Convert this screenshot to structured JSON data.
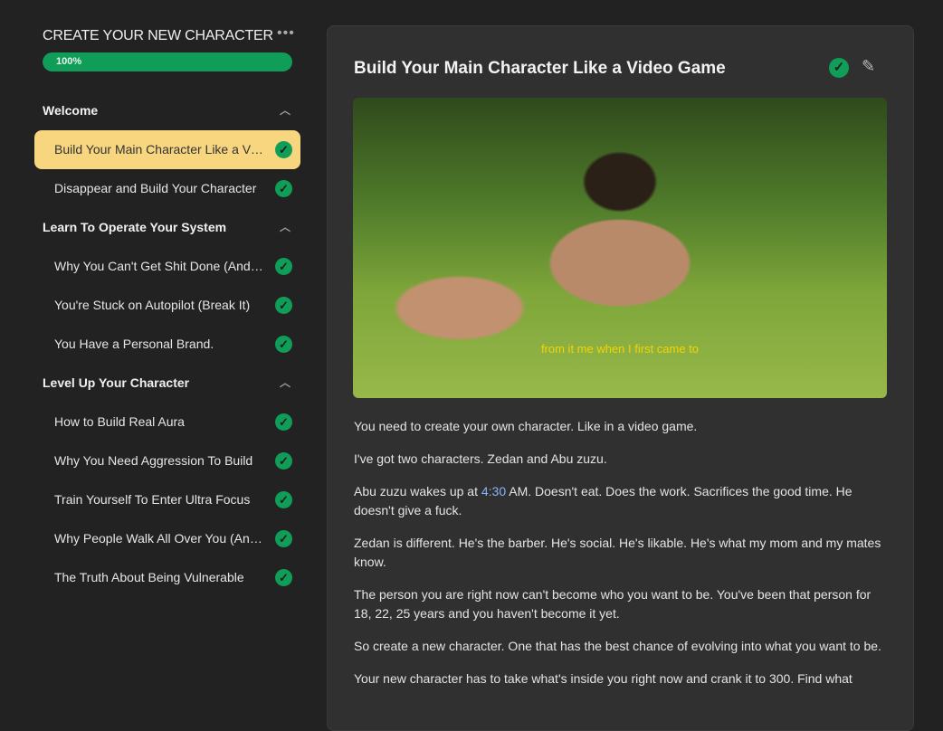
{
  "sidebar": {
    "course_title": "CREATE YOUR NEW CHARACTER",
    "progress_label": "100%",
    "progress_percent": 100,
    "sections": [
      {
        "title": "Welcome",
        "lessons": [
          "Build Your Main Character Like a Video Game",
          "Disappear and Build Your Character"
        ]
      },
      {
        "title": "Learn To Operate Your System",
        "lessons": [
          "Why You Can't Get Shit Done (And How to Fix It)",
          "You're Stuck on Autopilot (Break It)",
          "You Have a Personal Brand."
        ]
      },
      {
        "title": "Level Up Your Character",
        "lessons": [
          "How to Build Real Aura",
          "Why You Need Aggression To Build",
          "Train Yourself To Enter Ultra Focus",
          "Why People Walk All Over You (And How to Stop It)",
          "The Truth About Being Vulnerable"
        ]
      }
    ]
  },
  "main": {
    "title": "Build Your Main Character Like a Video Game",
    "video_subtitle": "from it me when I first came to",
    "paragraphs": [
      "You need to create your own character. Like in a video game.",
      "I've got two characters. Zedan and Abu zuzu.",
      {
        "before": "Abu zuzu wakes up at ",
        "link": "4:30",
        "after": " AM. Doesn't eat. Does the work. Sacrifices the good time. He doesn't give a fuck."
      },
      "Zedan is different. He's the barber. He's social. He's likable. He's what my mom and my mates know.",
      "The person you are right now can't become who you want to be. You've been that person for 18, 22, 25 years and you haven't become it yet.",
      "So create a new character. One that has the best chance of evolving into what you want to be.",
      "Your new character has to take what's inside you right now and crank it to 300. Find what"
    ]
  }
}
